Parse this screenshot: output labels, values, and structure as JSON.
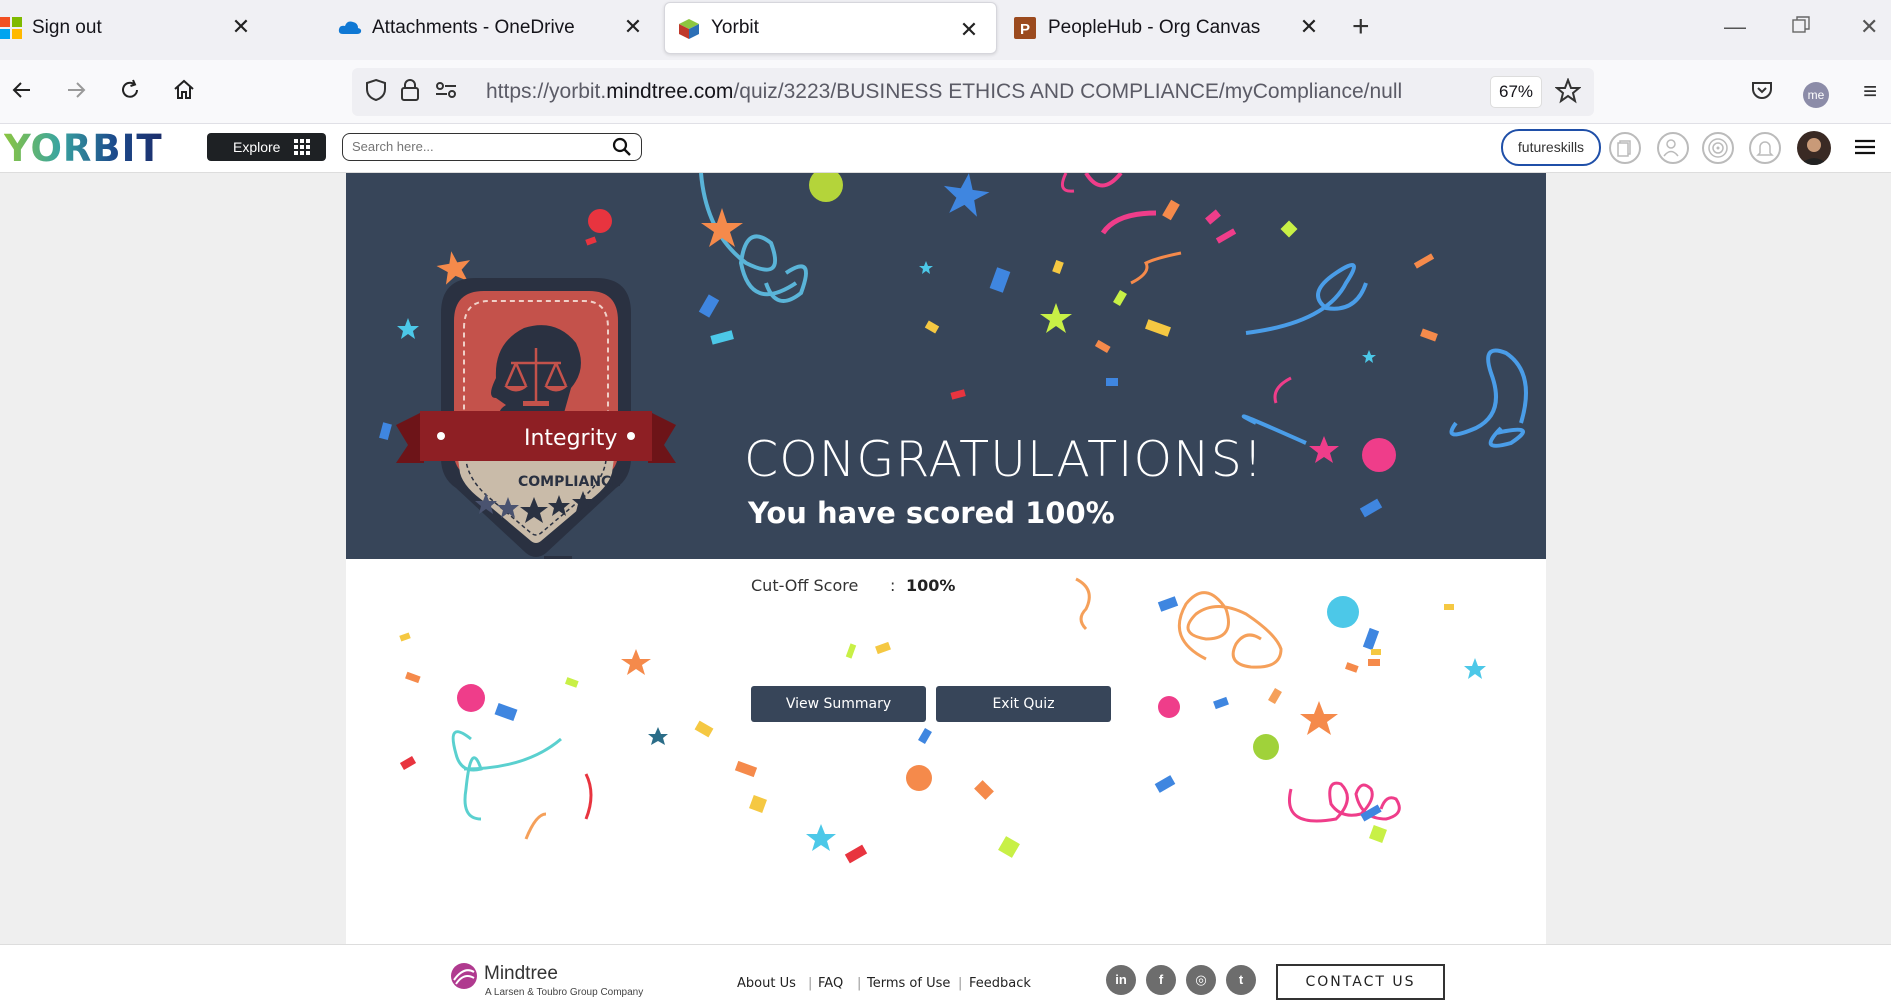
{
  "browser": {
    "tabs": [
      {
        "title": "Sign out",
        "icon": "microsoft-icon"
      },
      {
        "title": "Attachments - OneDrive",
        "icon": "onedrive-icon"
      },
      {
        "title": "Yorbit",
        "icon": "yorbit-icon",
        "active": true
      },
      {
        "title": "PeopleHub - Org Canvas",
        "icon": "peoplehub-icon"
      }
    ],
    "close_glyph": "✕",
    "new_tab_glyph": "+",
    "url_prefix": "https://yorbit.",
    "url_domain": "mindtree.com",
    "url_path": "/quiz/3223/BUSINESS ETHICS AND COMPLIANCE/myCompliance/null",
    "zoom": "67%",
    "account_initials": "me"
  },
  "site": {
    "logo": "YORBIT",
    "explore_label": "Explore",
    "search_placeholder": "Search here...",
    "futureskills_label": "futureskills"
  },
  "result": {
    "badge_ribbon": "Integrity",
    "badge_sub": "COMPLIANCE",
    "congrats": "CONGRATULATIONS!",
    "score_text": "You have scored 100%",
    "cutoff_label": "Cut-Off Score",
    "cutoff_colon": ":",
    "cutoff_value": "100%",
    "view_summary_label": "View Summary",
    "exit_quiz_label": "Exit Quiz"
  },
  "footer": {
    "brand": "Mindtree",
    "tagline": "A Larsen & Toubro Group Company",
    "links": [
      "About Us",
      "FAQ",
      "Terms of Use",
      "Feedback"
    ],
    "social": [
      {
        "name": "linkedin-icon",
        "glyph": "in"
      },
      {
        "name": "facebook-icon",
        "glyph": "f"
      },
      {
        "name": "instagram-icon",
        "glyph": "◎"
      },
      {
        "name": "twitter-icon",
        "glyph": "t"
      }
    ],
    "contact_label": "CONTACT US"
  },
  "colors": {
    "banner_bg": "#374559",
    "button_bg": "#374559",
    "badge_red": "#c4524b",
    "ribbon_red": "#8e1f24",
    "yorbit_green": "#8dc63f",
    "yorbit_blue": "#1c4a8c"
  }
}
